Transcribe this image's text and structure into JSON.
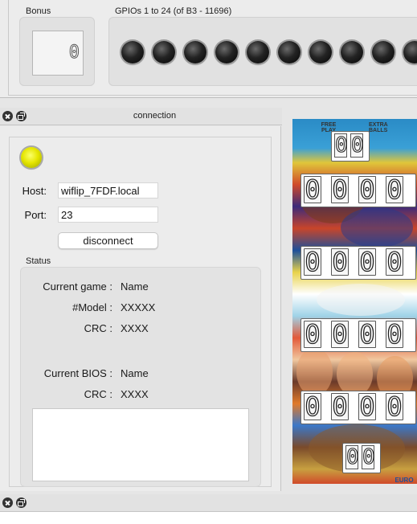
{
  "top_panel": {
    "bonus_title": "Bonus",
    "bonus_value": "0",
    "gpio_title": "GPIOs 1 to 24 (of B3 - 11696)",
    "gpio_count_visible": 10
  },
  "connection_window": {
    "title": "connection",
    "status_led_color": "#e6e600",
    "host_label": "Host:",
    "host_value": "wiflip_7FDF.local",
    "port_label": "Port:",
    "port_value": "23",
    "disconnect_label": "disconnect",
    "status_title": "Status",
    "status": {
      "current_game_label": "Current game :",
      "current_game_value": "Name",
      "model_label": "#Model :",
      "model_value": "XXXXX",
      "crc_label": "CRC :",
      "crc_value": "XXXX",
      "current_bios_label": "Current BIOS :",
      "current_bios_value": "Name",
      "bios_crc_label": "CRC :",
      "bios_crc_value": "XXXX"
    },
    "log_text": ""
  },
  "backglass": {
    "free_play_text": "FREE PLAY",
    "extra_balls_text": "EXTRA BALLS",
    "credit_digits": [
      "0",
      "0"
    ],
    "player_scores": [
      [
        "0",
        "0",
        "0",
        "0"
      ],
      [
        "0",
        "0",
        "0",
        "0"
      ],
      [
        "0",
        "0",
        "0",
        "0"
      ],
      [
        "0",
        "0",
        "0",
        "0"
      ]
    ],
    "ball_digits": [
      "0",
      "0"
    ],
    "corner_text": "EURO"
  },
  "bottom_window": {
    "title": ""
  }
}
